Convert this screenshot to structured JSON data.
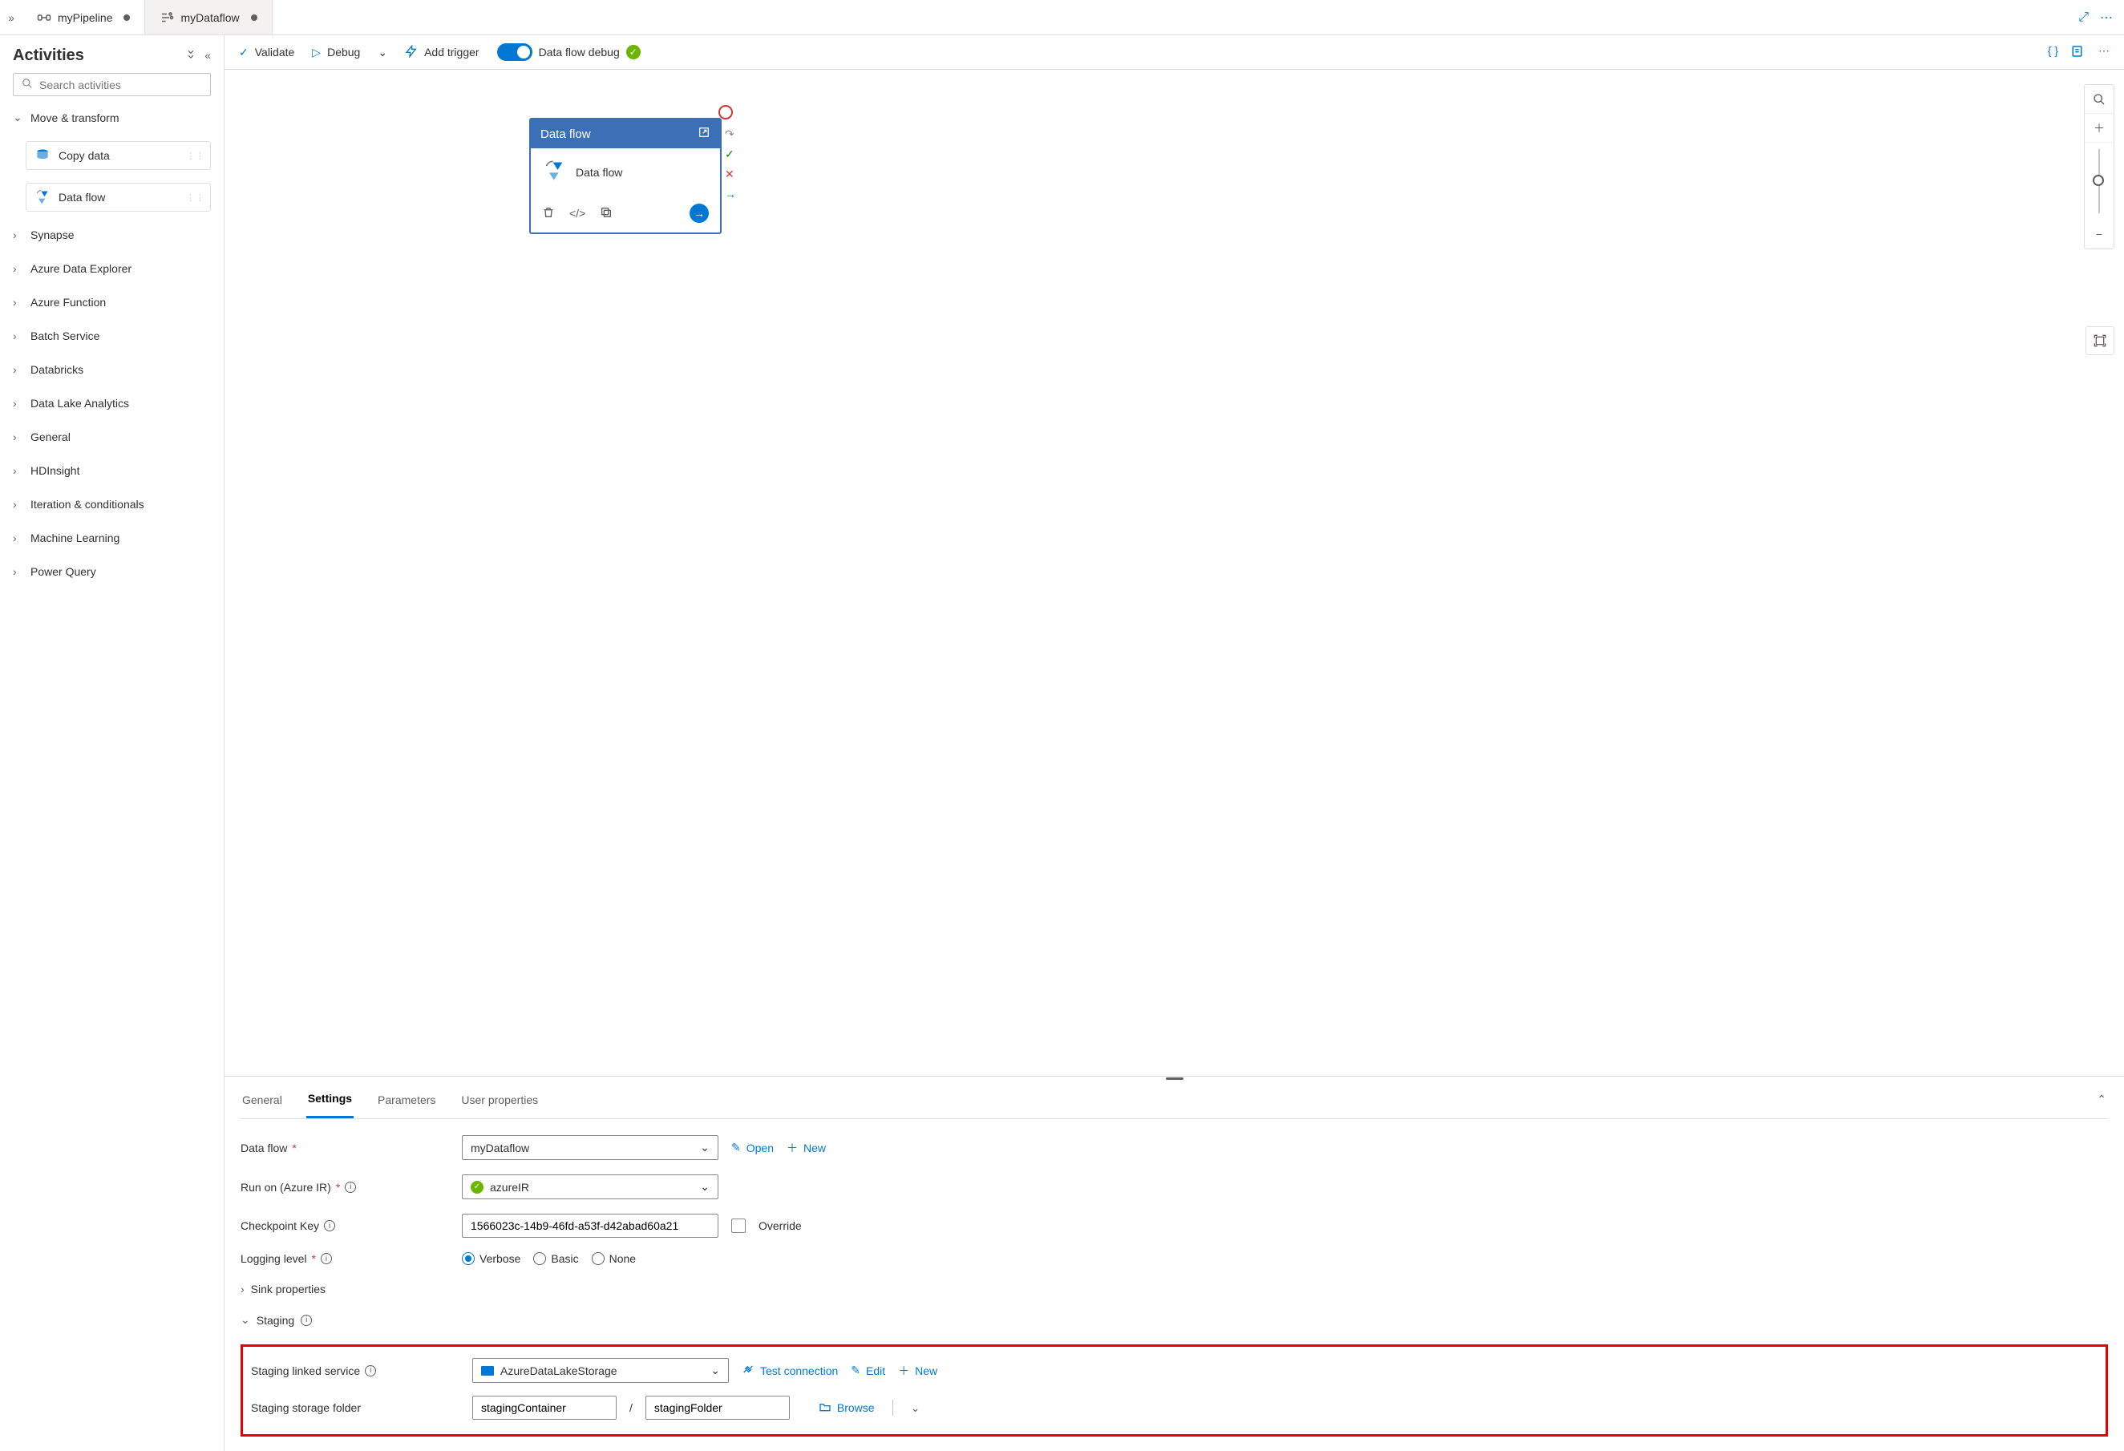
{
  "tabs": [
    {
      "label": "myPipeline",
      "dirty": true
    },
    {
      "label": "myDataflow",
      "dirty": true
    }
  ],
  "sidebar": {
    "title": "Activities",
    "search_placeholder": "Search activities",
    "open_category": "Move & transform",
    "activities": [
      {
        "label": "Copy data"
      },
      {
        "label": "Data flow"
      }
    ],
    "categories": [
      "Synapse",
      "Azure Data Explorer",
      "Azure Function",
      "Batch Service",
      "Databricks",
      "Data Lake Analytics",
      "General",
      "HDInsight",
      "Iteration & conditionals",
      "Machine Learning",
      "Power Query"
    ]
  },
  "toolbar": {
    "validate": "Validate",
    "debug": "Debug",
    "add_trigger": "Add trigger",
    "debug_label": "Data flow debug"
  },
  "node": {
    "title": "Data flow",
    "body": "Data flow"
  },
  "panel": {
    "tabs": [
      "General",
      "Settings",
      "Parameters",
      "User properties"
    ],
    "active_tab": "Settings",
    "dataflow_label": "Data flow",
    "dataflow_value": "myDataflow",
    "open": "Open",
    "new": "New",
    "runon_label": "Run on (Azure IR)",
    "runon_value": "azureIR",
    "checkpoint_label": "Checkpoint Key",
    "checkpoint_value": "1566023c-14b9-46fd-a53f-d42abad60a21",
    "override": "Override",
    "logging_label": "Logging level",
    "log_verbose": "Verbose",
    "log_basic": "Basic",
    "log_none": "None",
    "sink_props": "Sink properties",
    "staging": "Staging",
    "staging_ls_label": "Staging linked service",
    "staging_ls_value": "AzureDataLakeStorage",
    "test_conn": "Test connection",
    "edit": "Edit",
    "staging_folder_label": "Staging storage folder",
    "staging_container": "stagingContainer",
    "staging_folder": "stagingFolder",
    "browse": "Browse"
  }
}
